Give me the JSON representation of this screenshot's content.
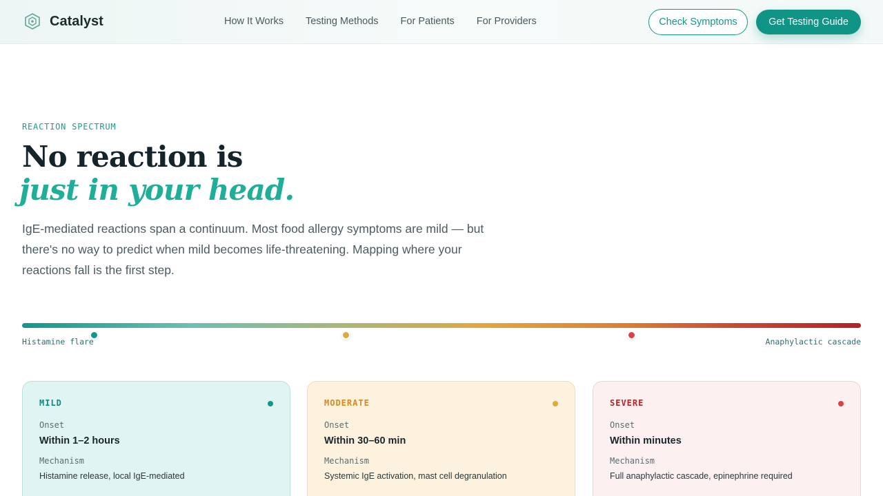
{
  "brand": {
    "name": "Catalyst",
    "logo_icon": "shield-hex-icon"
  },
  "nav": {
    "links": [
      "How It Works",
      "Testing Methods",
      "For Patients",
      "For Providers"
    ],
    "check_symptoms": "Check Symptoms",
    "get_guide": "Get Testing Guide"
  },
  "hero": {
    "eyebrow": "REACTION SPECTRUM",
    "headline_line1": "No reaction is",
    "headline_line2": "just in your head.",
    "lede": "IgE-mediated reactions span a continuum. Most food allergy symptoms are mild — but there's no way to predict when mild becomes life-threatening. Mapping where your reactions fall is the first step."
  },
  "spectrum": {
    "left_label": "Histamine flare",
    "right_label": "Anaphylactic cascade",
    "markers": [
      {
        "name": "mild",
        "color": "#12968a"
      },
      {
        "name": "moderate",
        "color": "#e0a83e"
      },
      {
        "name": "severe",
        "color": "#dc3f44"
      }
    ]
  },
  "cards": [
    {
      "title": "MILD",
      "accent": "#0f8b7e",
      "dot": "#12968a",
      "onset_label": "Onset",
      "onset": "Within 1–2 hours",
      "mechanism_label": "Mechanism",
      "mechanism": "Histamine release, local IgE-mediated"
    },
    {
      "title": "MODERATE",
      "accent": "#d38a23",
      "dot": "#e0a83e",
      "onset_label": "Onset",
      "onset": "Within 30–60 min",
      "mechanism_label": "Mechanism",
      "mechanism": "Systemic IgE activation, mast cell degranulation"
    },
    {
      "title": "SEVERE",
      "accent": "#b42428",
      "dot": "#dc3f44",
      "onset_label": "Onset",
      "onset": "Within minutes",
      "mechanism_label": "Mechanism",
      "mechanism": "Full anaphylactic cascade, epinephrine required"
    }
  ]
}
